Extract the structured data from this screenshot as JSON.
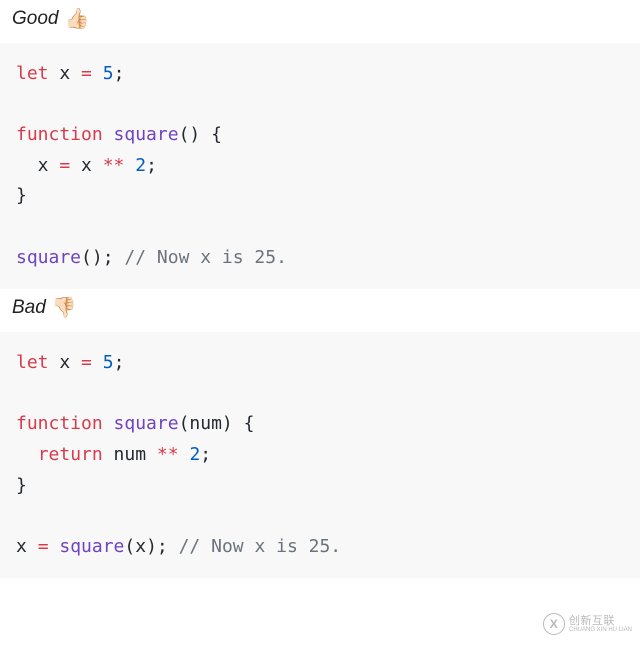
{
  "sections": [
    {
      "label": "Good",
      "emoji": "👍🏻",
      "code": [
        [
          {
            "cls": "tok-kw",
            "t": "let"
          },
          {
            "cls": "tok-var",
            "t": " x "
          },
          {
            "cls": "tok-op",
            "t": "="
          },
          {
            "cls": "tok-var",
            "t": " "
          },
          {
            "cls": "tok-num",
            "t": "5"
          },
          {
            "cls": "tok-var",
            "t": ";"
          }
        ],
        [],
        [
          {
            "cls": "tok-kw",
            "t": "function"
          },
          {
            "cls": "tok-var",
            "t": " "
          },
          {
            "cls": "tok-fn",
            "t": "square"
          },
          {
            "cls": "tok-var",
            "t": "() {"
          }
        ],
        [
          {
            "cls": "tok-var",
            "t": "  x "
          },
          {
            "cls": "tok-op",
            "t": "="
          },
          {
            "cls": "tok-var",
            "t": " x "
          },
          {
            "cls": "tok-op",
            "t": "**"
          },
          {
            "cls": "tok-var",
            "t": " "
          },
          {
            "cls": "tok-num",
            "t": "2"
          },
          {
            "cls": "tok-var",
            "t": ";"
          }
        ],
        [
          {
            "cls": "tok-var",
            "t": "}"
          }
        ],
        [],
        [
          {
            "cls": "tok-fn",
            "t": "square"
          },
          {
            "cls": "tok-var",
            "t": "(); "
          },
          {
            "cls": "tok-cmt",
            "t": "// Now x is 25."
          }
        ]
      ]
    },
    {
      "label": "Bad",
      "emoji": "👎🏻",
      "code": [
        [
          {
            "cls": "tok-kw",
            "t": "let"
          },
          {
            "cls": "tok-var",
            "t": " x "
          },
          {
            "cls": "tok-op",
            "t": "="
          },
          {
            "cls": "tok-var",
            "t": " "
          },
          {
            "cls": "tok-num",
            "t": "5"
          },
          {
            "cls": "tok-var",
            "t": ";"
          }
        ],
        [],
        [
          {
            "cls": "tok-kw",
            "t": "function"
          },
          {
            "cls": "tok-var",
            "t": " "
          },
          {
            "cls": "tok-fn",
            "t": "square"
          },
          {
            "cls": "tok-var",
            "t": "(num) {"
          }
        ],
        [
          {
            "cls": "tok-var",
            "t": "  "
          },
          {
            "cls": "tok-kw",
            "t": "return"
          },
          {
            "cls": "tok-var",
            "t": " num "
          },
          {
            "cls": "tok-op",
            "t": "**"
          },
          {
            "cls": "tok-var",
            "t": " "
          },
          {
            "cls": "tok-num",
            "t": "2"
          },
          {
            "cls": "tok-var",
            "t": ";"
          }
        ],
        [
          {
            "cls": "tok-var",
            "t": "}"
          }
        ],
        [],
        [
          {
            "cls": "tok-var",
            "t": "x "
          },
          {
            "cls": "tok-op",
            "t": "="
          },
          {
            "cls": "tok-var",
            "t": " "
          },
          {
            "cls": "tok-fn",
            "t": "square"
          },
          {
            "cls": "tok-var",
            "t": "(x); "
          },
          {
            "cls": "tok-cmt",
            "t": "// Now x is 25."
          }
        ]
      ]
    }
  ],
  "watermark": {
    "logo": "X",
    "main": "创新互联",
    "sub": "CHUANG XIN HU LIAN"
  }
}
